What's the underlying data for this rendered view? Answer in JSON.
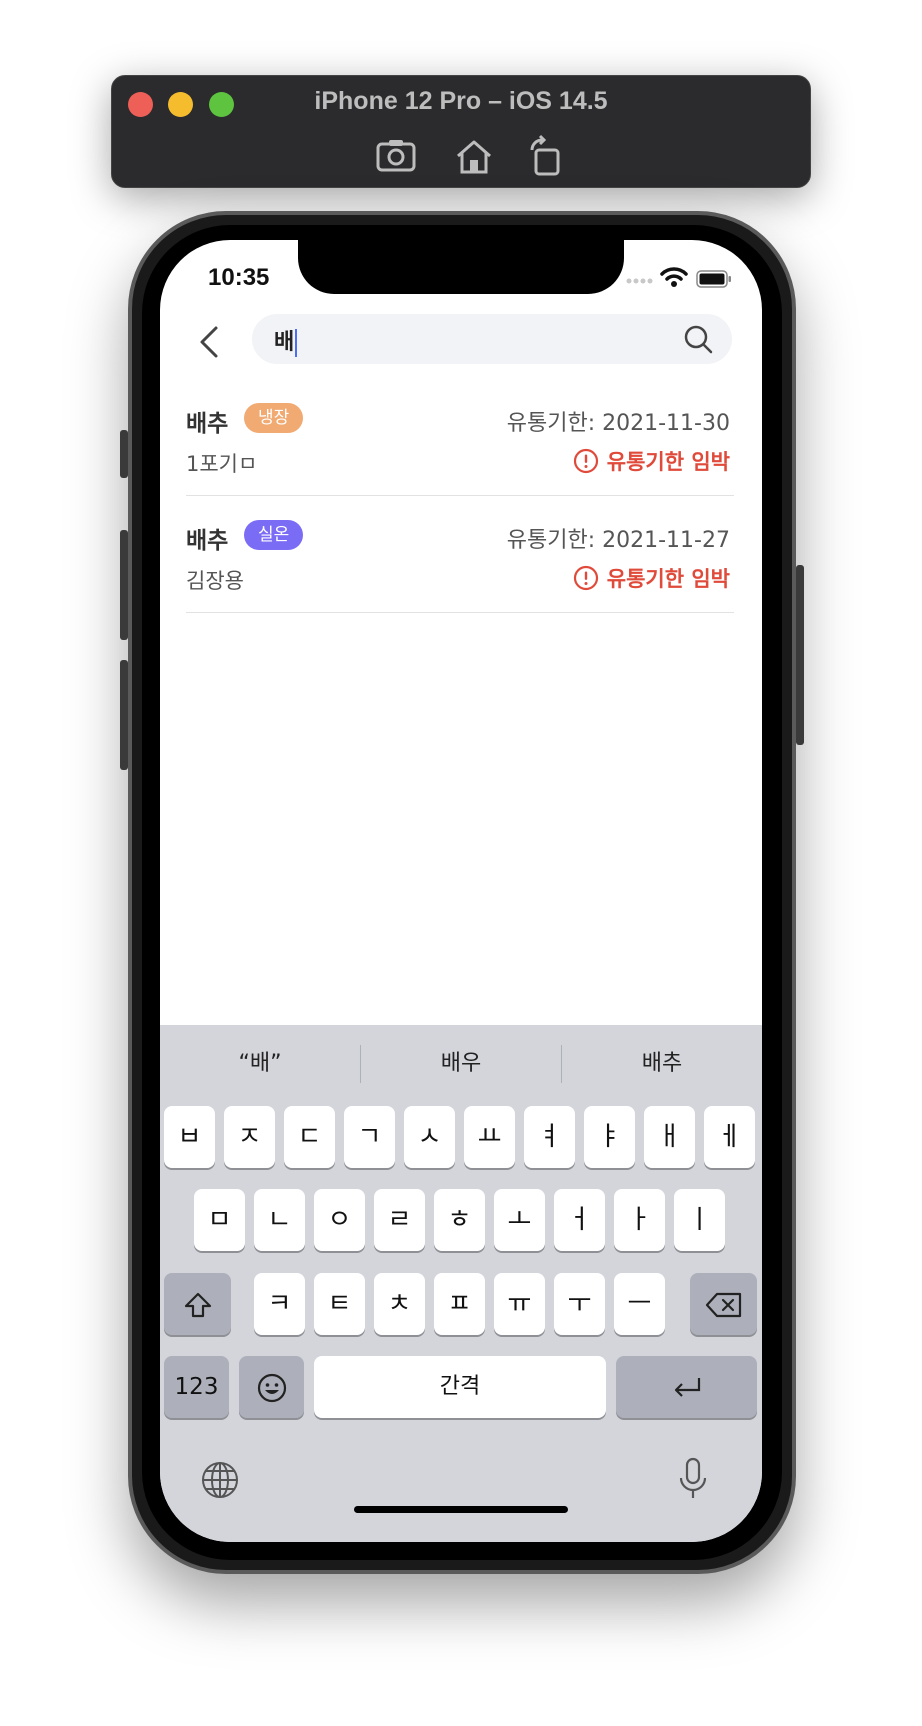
{
  "simulator": {
    "title": "iPhone 12 Pro – iOS 14.5",
    "tools": [
      "screenshot-icon",
      "home-icon",
      "rotate-icon"
    ]
  },
  "status_bar": {
    "time": "10:35"
  },
  "search": {
    "value": "배"
  },
  "results": [
    {
      "name": "배추",
      "tag": "냉장",
      "tag_color": "#f0aa72",
      "expiry": "유통기한: 2021-11-30",
      "note": "1포기ㅁ",
      "warning": "유통기한 임박"
    },
    {
      "name": "배추",
      "tag": "실온",
      "tag_color": "#7b6cf6",
      "expiry": "유통기한: 2021-11-27",
      "note": "김장용",
      "warning": "유통기한 임박"
    }
  ],
  "colors": {
    "warning": "#e04a3a",
    "search_bg": "#f2f3f6",
    "keyboard_bg": "#d3d5db"
  },
  "keyboard": {
    "suggestions": [
      "“배”",
      "배우",
      "배추"
    ],
    "row1": [
      "ㅂ",
      "ㅈ",
      "ㄷ",
      "ㄱ",
      "ㅅ",
      "ㅛ",
      "ㅕ",
      "ㅑ",
      "ㅐ",
      "ㅔ"
    ],
    "row2": [
      "ㅁ",
      "ㄴ",
      "ㅇ",
      "ㄹ",
      "ㅎ",
      "ㅗ",
      "ㅓ",
      "ㅏ",
      "ㅣ"
    ],
    "row3": [
      "ㅋ",
      "ㅌ",
      "ㅊ",
      "ㅍ",
      "ㅠ",
      "ㅜ",
      "ㅡ"
    ],
    "numbers_label": "123",
    "space_label": "간격"
  }
}
